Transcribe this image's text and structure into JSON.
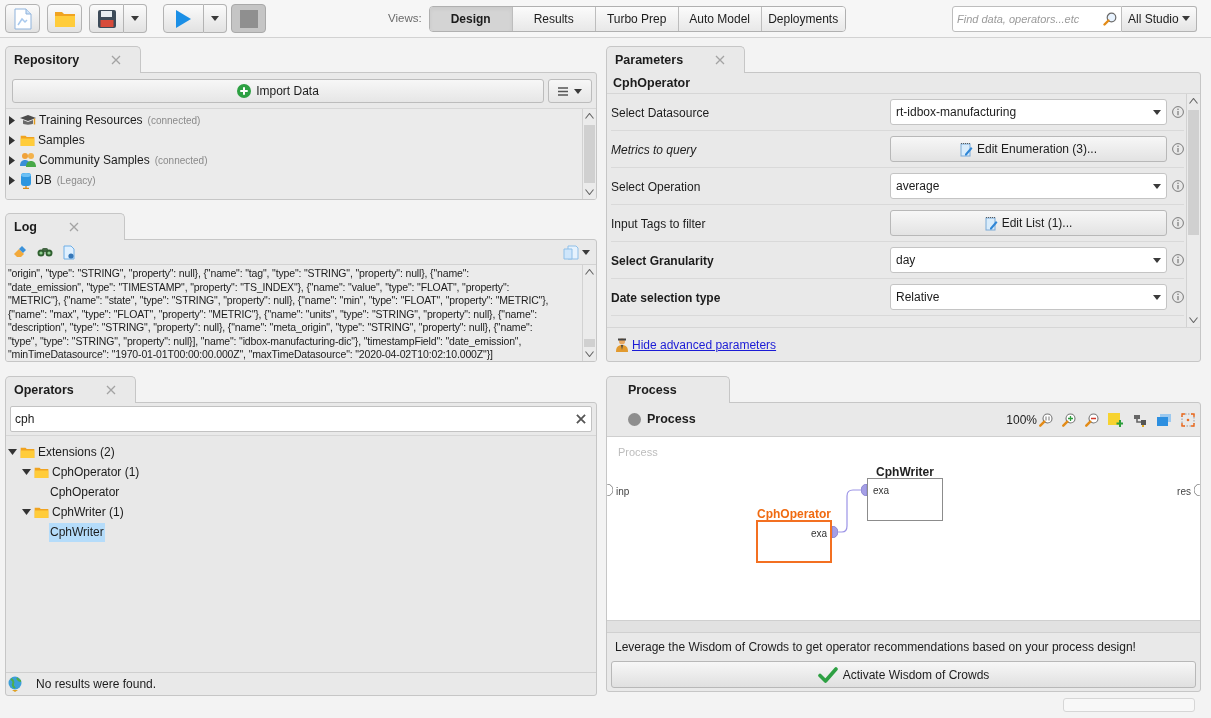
{
  "toolbar": {
    "buttons": [
      {
        "kind": "new",
        "disabled": false,
        "dropdown": false
      },
      {
        "kind": "open",
        "disabled": false,
        "dropdown": false
      },
      {
        "kind": "save",
        "disabled": false,
        "dropdown": true
      },
      {
        "kind": "run",
        "disabled": false,
        "dropdown": true
      },
      {
        "kind": "stop",
        "disabled": true,
        "dropdown": false
      }
    ]
  },
  "views": {
    "label": "Views:",
    "tabs": [
      {
        "label": "Design",
        "selected": true
      },
      {
        "label": "Results",
        "selected": false
      },
      {
        "label": "Turbo Prep",
        "selected": false
      },
      {
        "label": "Auto Model",
        "selected": false
      },
      {
        "label": "Deployments",
        "selected": false
      }
    ]
  },
  "global_search": {
    "placeholder": "Find data, operators...etc",
    "scope": "All Studio"
  },
  "repository": {
    "tab": {
      "label": "Repository",
      "closable": true
    },
    "import_button": "Import Data",
    "items": [
      {
        "kind": "training",
        "label": "Training Resources",
        "note": "(connected)",
        "expanded": false
      },
      {
        "kind": "folder",
        "label": "Samples",
        "expanded": false
      },
      {
        "kind": "community",
        "label": "Community Samples",
        "note": "(connected)",
        "expanded": false
      },
      {
        "kind": "database",
        "label": "DB",
        "note": "(Legacy)",
        "expanded": false
      }
    ]
  },
  "log": {
    "tab": {
      "label": "Log",
      "closable": true
    },
    "lines": [
      "\"origin\", \"type\": \"STRING\", \"property\": null}, {\"name\": \"tag\", \"type\": \"STRING\", \"property\": null}, {\"name\":",
      "\"date_emission\", \"type\": \"TIMESTAMP\", \"property\": \"TS_INDEX\"}, {\"name\": \"value\", \"type\": \"FLOAT\", \"property\":",
      "\"METRIC\"}, {\"name\": \"state\", \"type\": \"STRING\", \"property\": null}, {\"name\": \"min\", \"type\": \"FLOAT\", \"property\": \"METRIC\"},",
      "{\"name\": \"max\", \"type\": \"FLOAT\", \"property\": \"METRIC\"}, {\"name\": \"units\", \"type\": \"STRING\", \"property\": null}, {\"name\":",
      "\"description\", \"type\": \"STRING\", \"property\": null}, {\"name\": \"meta_origin\", \"type\": \"STRING\", \"property\": null}, {\"name\":",
      "\"type\", \"type\": \"STRING\", \"property\": null}], \"name\": \"idbox-manufacturing-dic\"}, \"timestampField\": \"date_emission\",",
      "\"minTimeDatasource\": \"1970-01-01T00:00:00.000Z\", \"maxTimeDatasource\": \"2020-04-02T10:02:10.000Z\"}]"
    ]
  },
  "operators": {
    "tab": {
      "label": "Operators",
      "closable": true
    },
    "search": {
      "value": "cph"
    },
    "tree": [
      {
        "label": "Extensions (2)",
        "expanded": true,
        "selected": false,
        "children": [
          {
            "label": "CphOperator (1)",
            "expanded": true,
            "selected": false,
            "children": [
              {
                "label": "CphOperator",
                "selected": false
              }
            ]
          },
          {
            "label": "CphWriter (1)",
            "expanded": true,
            "selected": false,
            "children": [
              {
                "label": "CphWriter",
                "selected": true
              }
            ]
          }
        ]
      }
    ],
    "status": "No results were found."
  },
  "parameters": {
    "tab": {
      "label": "Parameters",
      "closable": true
    },
    "operator": "CphOperator",
    "rows": [
      {
        "label": "Select Datasource",
        "bold": false,
        "italic": false,
        "kind": "dropdown",
        "value": "rt-idbox-manufacturing"
      },
      {
        "label": "Metrics to query",
        "bold": false,
        "italic": true,
        "kind": "button",
        "value": "Edit Enumeration (3)..."
      },
      {
        "label": "Select Operation",
        "bold": false,
        "italic": false,
        "kind": "dropdown",
        "value": "average"
      },
      {
        "label": "Input Tags to filter",
        "bold": false,
        "italic": false,
        "kind": "button",
        "value": "Edit List (1)..."
      },
      {
        "label": "Select Granularity",
        "bold": true,
        "italic": false,
        "kind": "dropdown",
        "value": "day"
      },
      {
        "label": "Date selection type",
        "bold": true,
        "italic": false,
        "kind": "dropdown",
        "value": "Relative"
      }
    ],
    "advanced_link": "Hide advanced parameters"
  },
  "process": {
    "tab": {
      "label": "Process",
      "closable": false
    },
    "title": "Process",
    "zoom": "100%",
    "canvas_label": "Process",
    "input_port": "inp",
    "output_port": "res",
    "operators": [
      {
        "name": "CphWriter",
        "selected": false,
        "port": {
          "label": "exa",
          "output": false,
          "connected": true
        }
      },
      {
        "name": "CphOperator",
        "selected": true,
        "port": {
          "label": "exa",
          "output": true,
          "connected": true
        }
      }
    ],
    "hint": "Leverage the Wisdom of Crowds to get operator recommendations based on your process design!",
    "activate_button": "Activate Wisdom of Crowds"
  }
}
